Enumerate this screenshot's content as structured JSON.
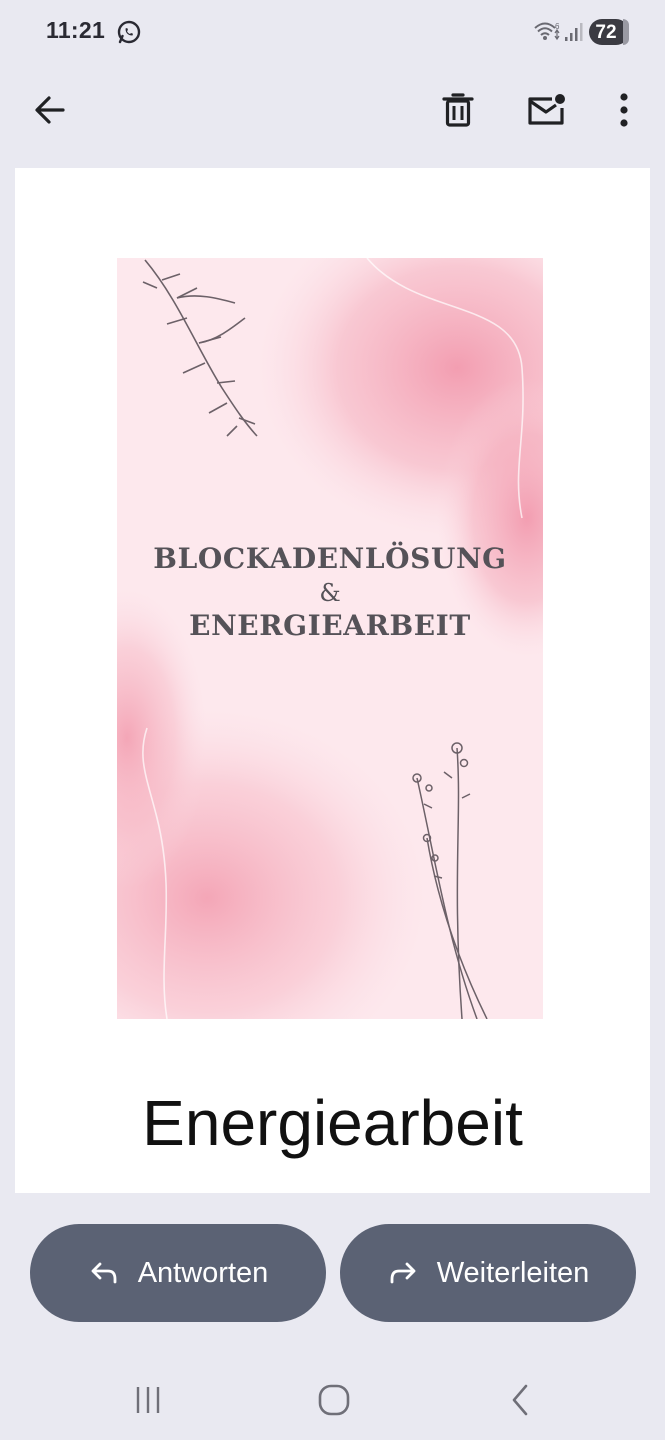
{
  "status_bar": {
    "time": "11:21",
    "battery": "72",
    "icons": [
      "whatsapp-icon",
      "wifi-icon",
      "signal-icon"
    ]
  },
  "toolbar": {
    "icons": [
      "arrow-back-icon",
      "trash-icon",
      "mail-unread-icon",
      "more-vert-icon"
    ]
  },
  "email": {
    "image_title_line1": "BLOCKADENLÖSUNG",
    "image_title_amp": "&",
    "image_title_line2": "ENERGIEARBEIT",
    "caption": "Energiearbeit"
  },
  "actions": {
    "reply_label": "Antworten",
    "forward_label": "Weiterleiten"
  },
  "nav": {
    "icons": [
      "recents-icon",
      "home-icon",
      "nav-back-icon"
    ]
  },
  "colors": {
    "background": "#e9e9f1",
    "button": "#5b6274",
    "card": "#ffffff",
    "hero_pink": "#f4a9b8"
  }
}
